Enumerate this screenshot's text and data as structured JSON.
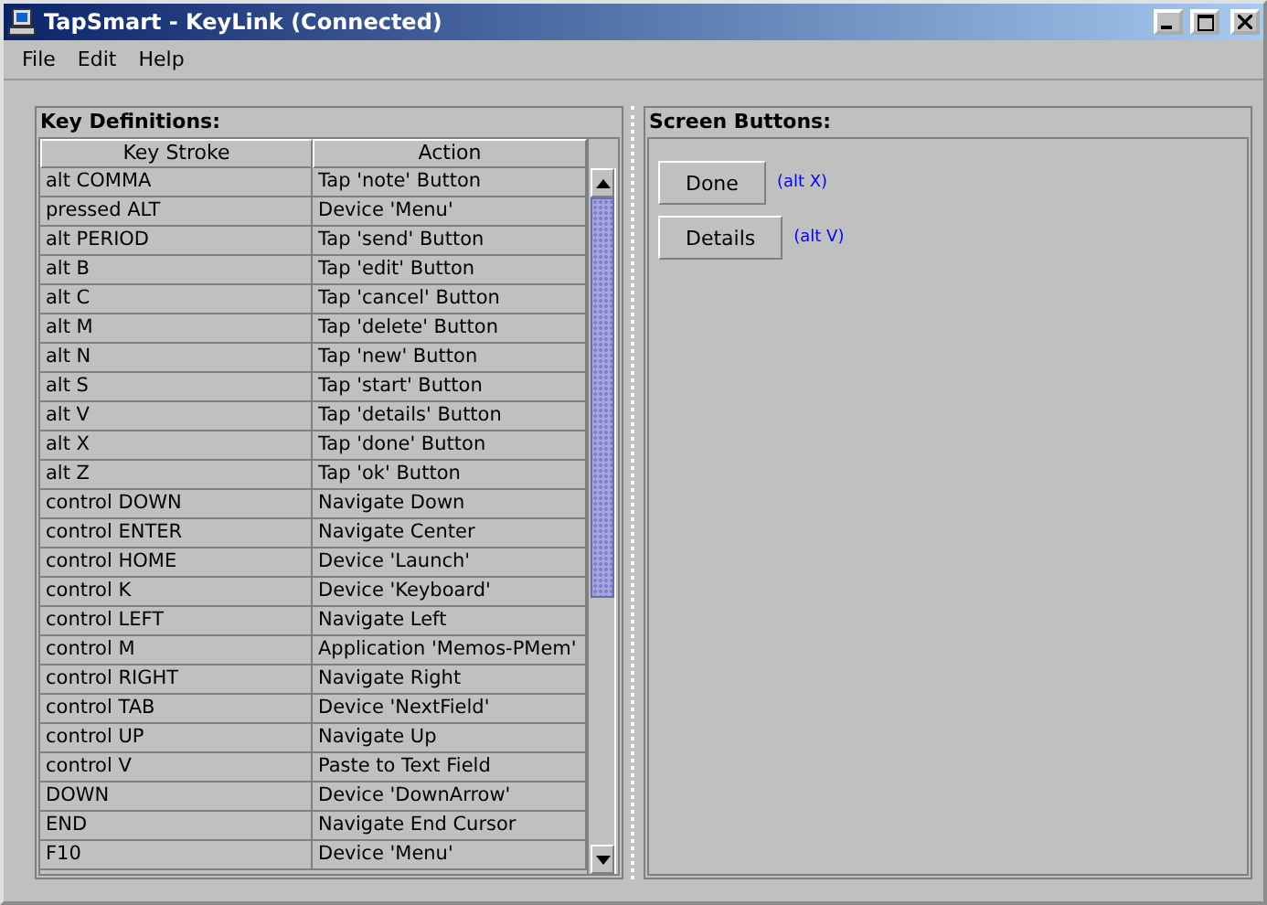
{
  "window": {
    "title": "TapSmart - KeyLink (Connected)"
  },
  "menu": [
    "File",
    "Edit",
    "Help"
  ],
  "key_definitions": {
    "title": "Key Definitions:",
    "columns": [
      "Key Stroke",
      "Action"
    ],
    "rows": [
      [
        "alt COMMA",
        "Tap 'note' Button"
      ],
      [
        "pressed ALT",
        "Device 'Menu'"
      ],
      [
        "alt PERIOD",
        "Tap 'send' Button"
      ],
      [
        "alt B",
        "Tap 'edit' Button"
      ],
      [
        "alt C",
        "Tap 'cancel' Button"
      ],
      [
        "alt M",
        "Tap 'delete' Button"
      ],
      [
        "alt N",
        "Tap 'new' Button"
      ],
      [
        "alt S",
        "Tap 'start' Button"
      ],
      [
        "alt V",
        "Tap 'details' Button"
      ],
      [
        "alt X",
        "Tap 'done' Button"
      ],
      [
        "alt Z",
        "Tap 'ok' Button"
      ],
      [
        "control DOWN",
        "Navigate Down"
      ],
      [
        "control ENTER",
        "Navigate Center"
      ],
      [
        "control HOME",
        "Device 'Launch'"
      ],
      [
        "control K",
        "Device 'Keyboard'"
      ],
      [
        "control LEFT",
        "Navigate Left"
      ],
      [
        "control M",
        "Application 'Memos-PMem'"
      ],
      [
        "control RIGHT",
        "Navigate Right"
      ],
      [
        "control TAB",
        "Device 'NextField'"
      ],
      [
        "control UP",
        "Navigate Up"
      ],
      [
        "control V",
        "Paste to Text Field"
      ],
      [
        "DOWN",
        "Device 'DownArrow'"
      ],
      [
        "END",
        "Navigate End Cursor"
      ],
      [
        "F10",
        "Device 'Menu'"
      ]
    ]
  },
  "screen_buttons": {
    "title": "Screen Buttons:",
    "buttons": [
      {
        "label": "Done",
        "shortcut": "(alt X)"
      },
      {
        "label": "Details",
        "shortcut": "(alt V)"
      }
    ]
  }
}
